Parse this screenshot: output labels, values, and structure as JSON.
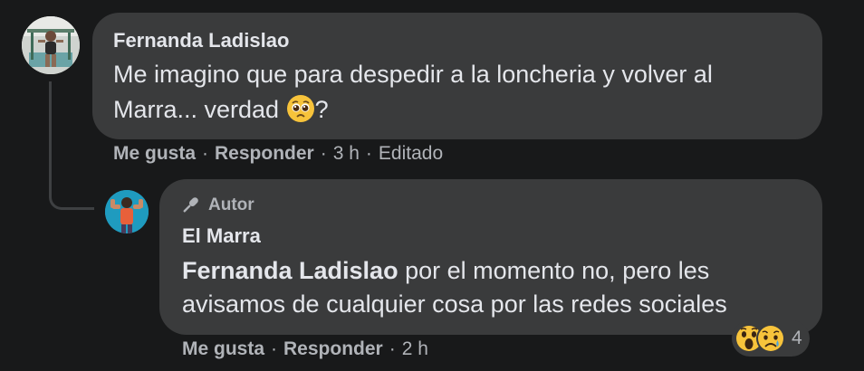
{
  "comments": [
    {
      "author": "Fernanda Ladislao",
      "text_line1": "Me imagino que para despedir a la loncheria y volver al",
      "text_line2_before": "Marra... verdad ",
      "text_line2_after": "?",
      "actions": {
        "like": "Me gusta",
        "reply": "Responder",
        "time": "3 h",
        "edited": "Editado"
      }
    }
  ],
  "reply": {
    "badge": "Autor",
    "author": "El Marra",
    "mention": "Fernanda Ladislao",
    "text_line1_rest": " por el momento no, pero les",
    "text_line2": "avisamos de cualquier cosa por las redes sociales",
    "actions": {
      "like": "Me gusta",
      "reply": "Responder",
      "time": "2 h"
    },
    "reaction_count": "4"
  },
  "separator": "·",
  "icons": {
    "comment_emoji": "pleading-face-icon",
    "badge_icon": "microphone-icon",
    "reactions": [
      "wow-reaction-icon",
      "sad-reaction-icon"
    ]
  },
  "colors": {
    "background": "#18191a",
    "bubble": "#3a3b3c",
    "text": "#e4e6eb",
    "secondary": "#b0b3b8",
    "thread_line": "#3e4042",
    "reaction_yellow": "#f7c33b"
  }
}
